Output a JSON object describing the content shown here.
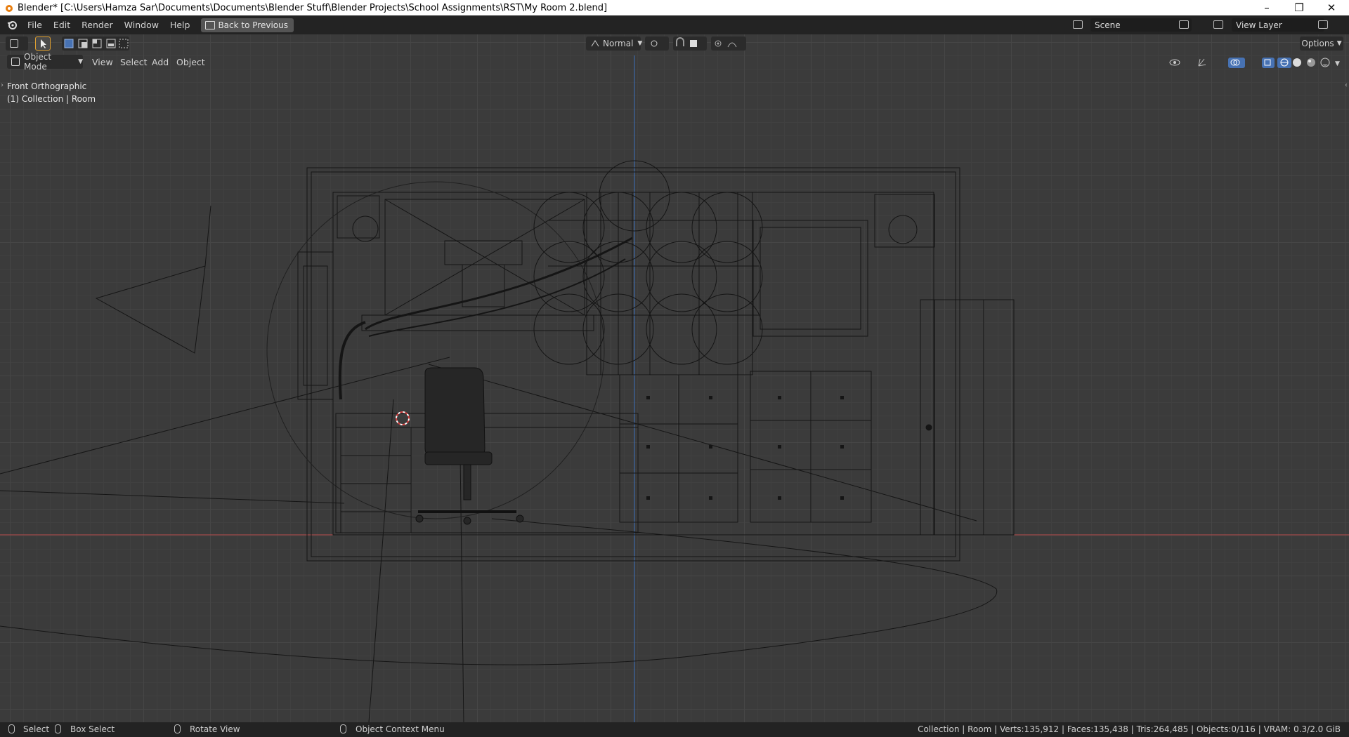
{
  "window": {
    "title": "Blender* [C:\\Users\\Hamza Sar\\Documents\\Documents\\Blender Stuff\\Blender Projects\\School Assignments\\RST\\My Room 2.blend]",
    "minimize": "–",
    "maximize": "❐",
    "close": "✕"
  },
  "topbar": {
    "menus": [
      "File",
      "Edit",
      "Render",
      "Window",
      "Help"
    ],
    "back_button": "Back to Previous",
    "scene_name": "Scene",
    "view_layer": "View Layer"
  },
  "viewport_header": {
    "pivot": "Normal",
    "options": "Options",
    "mode": "Object Mode",
    "menus": [
      "View",
      "Select",
      "Add",
      "Object"
    ]
  },
  "viewport": {
    "view_name": "Front Orthographic",
    "collection_info": "(1) Collection | Room"
  },
  "statusbar": {
    "select": "Select",
    "box_select": "Box Select",
    "rotate_view": "Rotate View",
    "context_menu": "Object Context Menu",
    "stats": "Collection | Room | Verts:135,912 | Faces:135,438 | Tris:264,485 | Objects:0/116 | VRAM: 0.3/2.0 GiB"
  },
  "colors": {
    "x_axis": "#b84c4c",
    "z_axis": "#3c6fb8",
    "viewport_bg": "#3b3b3b",
    "wire": "#151515"
  },
  "icons": [
    "blender-logo-icon",
    "editor-type-icon",
    "select-cursor-icon",
    "box-select-mode-icons",
    "transform-pivot-icon",
    "snap-icon",
    "proportional-edit-icon",
    "visibility-icon",
    "gizmo-icon",
    "overlay-icon",
    "xray-icon",
    "wireframe-shading-icon",
    "solid-shading-icon",
    "material-shading-icon",
    "rendered-shading-icon",
    "mouse-left-icon",
    "mouse-middle-icon",
    "mouse-right-icon"
  ]
}
